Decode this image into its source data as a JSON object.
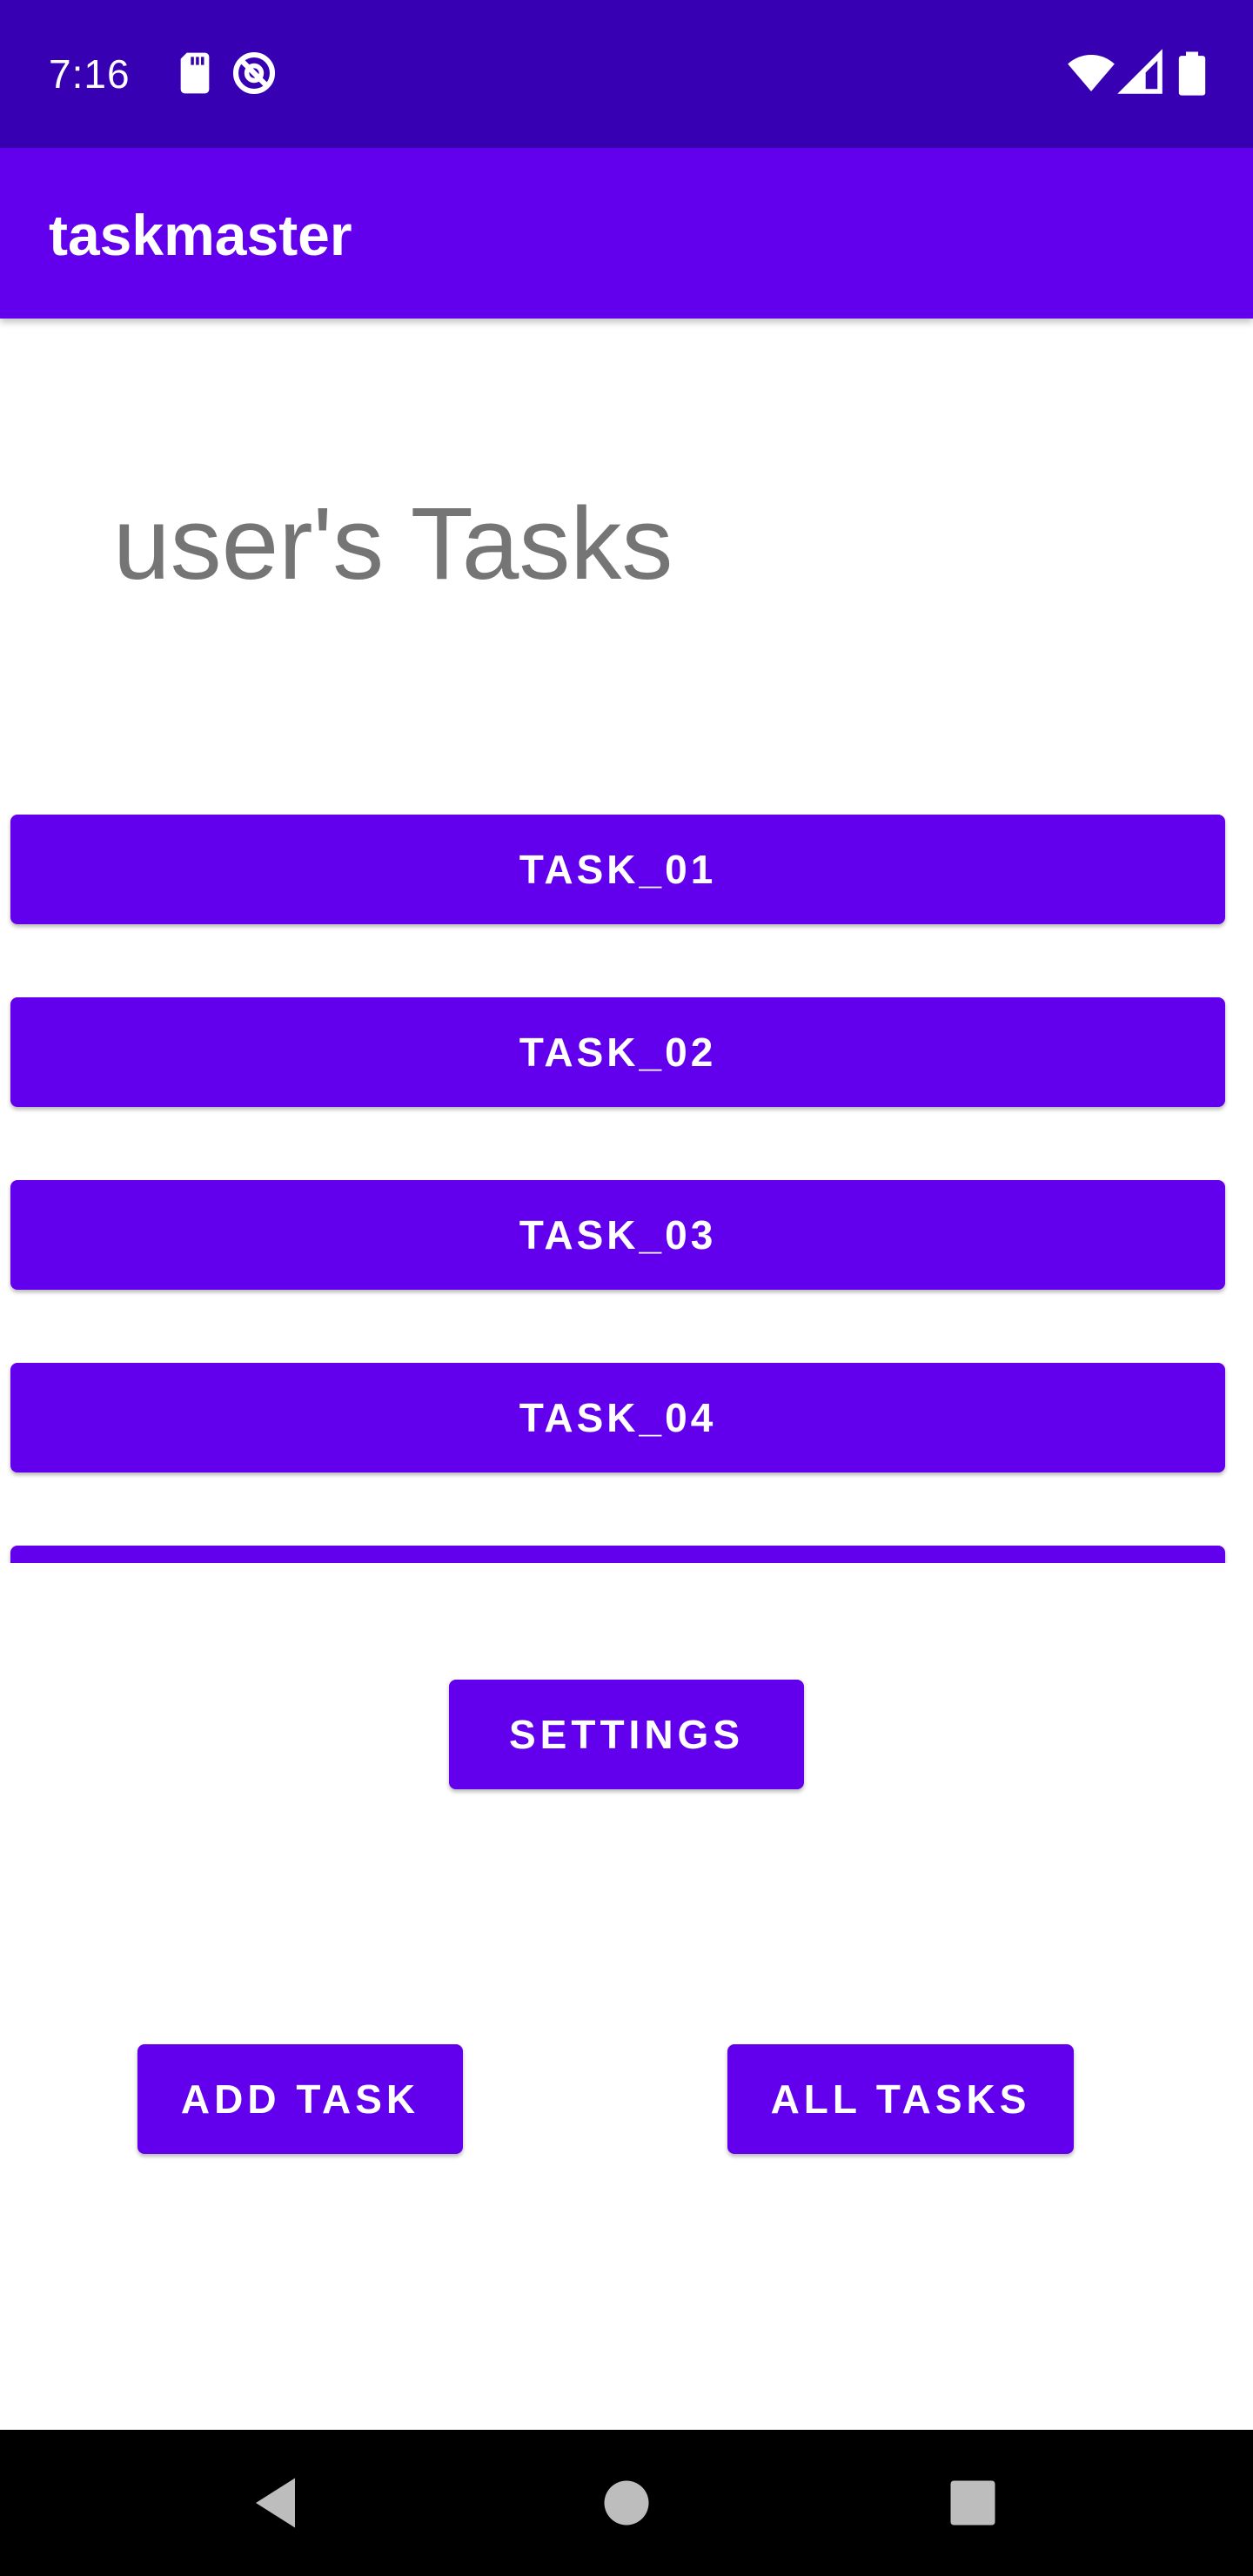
{
  "status_bar": {
    "time": "7:16",
    "left_icons": [
      "sd-card-icon",
      "data-saver-icon"
    ],
    "right_icons": [
      "wifi-icon",
      "signal-icon",
      "battery-icon"
    ]
  },
  "app_bar": {
    "title": "taskmaster"
  },
  "main": {
    "heading": "user's Tasks",
    "tasks": [
      {
        "label": "TASK_01"
      },
      {
        "label": "TASK_02"
      },
      {
        "label": "TASK_03"
      },
      {
        "label": "TASK_04"
      },
      {
        "label": ""
      }
    ],
    "settings_label": "SETTINGS",
    "add_task_label": "ADD TASK",
    "all_tasks_label": "ALL TASKS"
  },
  "nav_bar": {
    "icons": [
      "back-icon",
      "home-icon",
      "recents-icon"
    ]
  },
  "colors": {
    "status_bar": "#3700b3",
    "primary": "#6200ee",
    "heading_text": "#757575",
    "nav_bar": "#000000"
  }
}
